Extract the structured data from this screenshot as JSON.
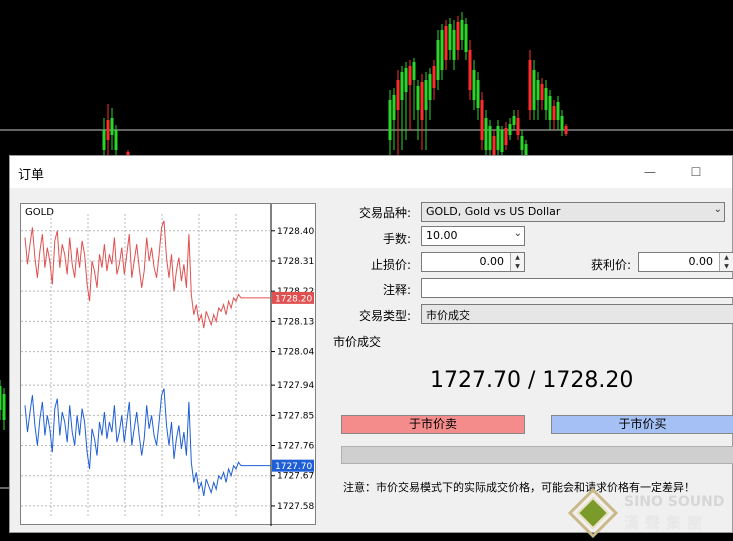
{
  "window": {
    "title": "订单",
    "minimize_icon": "minimize-icon",
    "maximize_icon": "maximize-icon"
  },
  "mini_chart": {
    "symbol": "GOLD",
    "ticks": [
      "1728.40",
      "1728.31",
      "1728.22",
      "1728.13",
      "1728.04",
      "1727.94",
      "1727.85",
      "1727.76",
      "1727.67",
      "1727.58"
    ],
    "ask_price": "1728.20",
    "bid_price": "1727.70",
    "ask_color": "#e05050",
    "bid_color": "#1f5fd6"
  },
  "chart_data": {
    "type": "line",
    "title": "GOLD",
    "ylim": [
      1727.55,
      1728.45
    ],
    "series": [
      {
        "values": [
          1728.38,
          1728.3,
          1728.36,
          1728.41,
          1728.32,
          1728.26,
          1728.34,
          1728.39,
          1728.29,
          1728.35,
          1728.31,
          1728.24,
          1728.37,
          1728.4,
          1728.29,
          1728.36,
          1728.33,
          1728.27,
          1728.38,
          1728.3,
          1728.26,
          1728.35,
          1728.29,
          1728.37,
          1728.33,
          1728.24,
          1728.19,
          1728.31,
          1728.28,
          1728.23,
          1728.33,
          1728.29,
          1728.36,
          1728.28,
          1728.33,
          1728.3,
          1728.38,
          1728.27,
          1728.3,
          1728.35,
          1728.27,
          1728.33,
          1728.39,
          1728.26,
          1728.31,
          1728.36,
          1728.29,
          1728.23,
          1728.28,
          1728.38,
          1728.31,
          1728.35,
          1728.29,
          1728.26,
          1728.33,
          1728.41,
          1728.43,
          1728.32,
          1728.26,
          1728.33,
          1728.22,
          1728.28,
          1728.32,
          1728.25,
          1728.3,
          1728.23,
          1728.39,
          1728.21,
          1728.15,
          1728.18,
          1728.13,
          1728.15,
          1728.11,
          1728.16,
          1728.14,
          1728.12,
          1728.15,
          1728.13,
          1728.17,
          1728.16,
          1728.18,
          1728.15,
          1728.19,
          1728.17,
          1728.2,
          1728.19,
          1728.21,
          1728.2
        ]
      },
      {
        "values": [
          1727.88,
          1727.8,
          1727.86,
          1727.91,
          1727.82,
          1727.76,
          1727.84,
          1727.89,
          1727.79,
          1727.85,
          1727.81,
          1727.74,
          1727.87,
          1727.9,
          1727.79,
          1727.86,
          1727.83,
          1727.77,
          1727.88,
          1727.8,
          1727.76,
          1727.85,
          1727.79,
          1727.87,
          1727.83,
          1727.74,
          1727.69,
          1727.81,
          1727.78,
          1727.73,
          1727.83,
          1727.79,
          1727.86,
          1727.78,
          1727.83,
          1727.8,
          1727.88,
          1727.77,
          1727.8,
          1727.85,
          1727.77,
          1727.83,
          1727.89,
          1727.76,
          1727.81,
          1727.86,
          1727.79,
          1727.73,
          1727.78,
          1727.88,
          1727.81,
          1727.85,
          1727.79,
          1727.76,
          1727.83,
          1727.91,
          1727.93,
          1727.82,
          1727.76,
          1727.83,
          1727.72,
          1727.78,
          1727.82,
          1727.75,
          1727.8,
          1727.73,
          1727.89,
          1727.71,
          1727.65,
          1727.68,
          1727.63,
          1727.65,
          1727.61,
          1727.66,
          1727.64,
          1727.62,
          1727.65,
          1727.63,
          1727.67,
          1727.66,
          1727.68,
          1727.65,
          1727.69,
          1727.67,
          1727.7,
          1727.69,
          1727.71,
          1727.7
        ]
      }
    ]
  },
  "form": {
    "symbol_label": "交易品种:",
    "symbol_value": "GOLD, Gold vs US Dollar",
    "volume_label": "手数:",
    "volume_value": "10.00",
    "sl_label": "止损价:",
    "sl_value": "0.00",
    "tp_label": "获利价:",
    "tp_value": "0.00",
    "comment_label": "注释:",
    "comment_value": "",
    "type_label": "交易类型:",
    "type_value": "市价成交"
  },
  "market": {
    "section_title": "市价成交",
    "bid": "1727.70",
    "separator": " / ",
    "ask": "1728.20",
    "sell_label": "于市价卖",
    "buy_label": "于市价买",
    "note": "注意：市价交易模式下的实际成交价格，可能会和请求价格有一定差异！"
  },
  "watermark": {
    "text_en": "SINO SOUND",
    "text_cn": "漢聲集團"
  }
}
